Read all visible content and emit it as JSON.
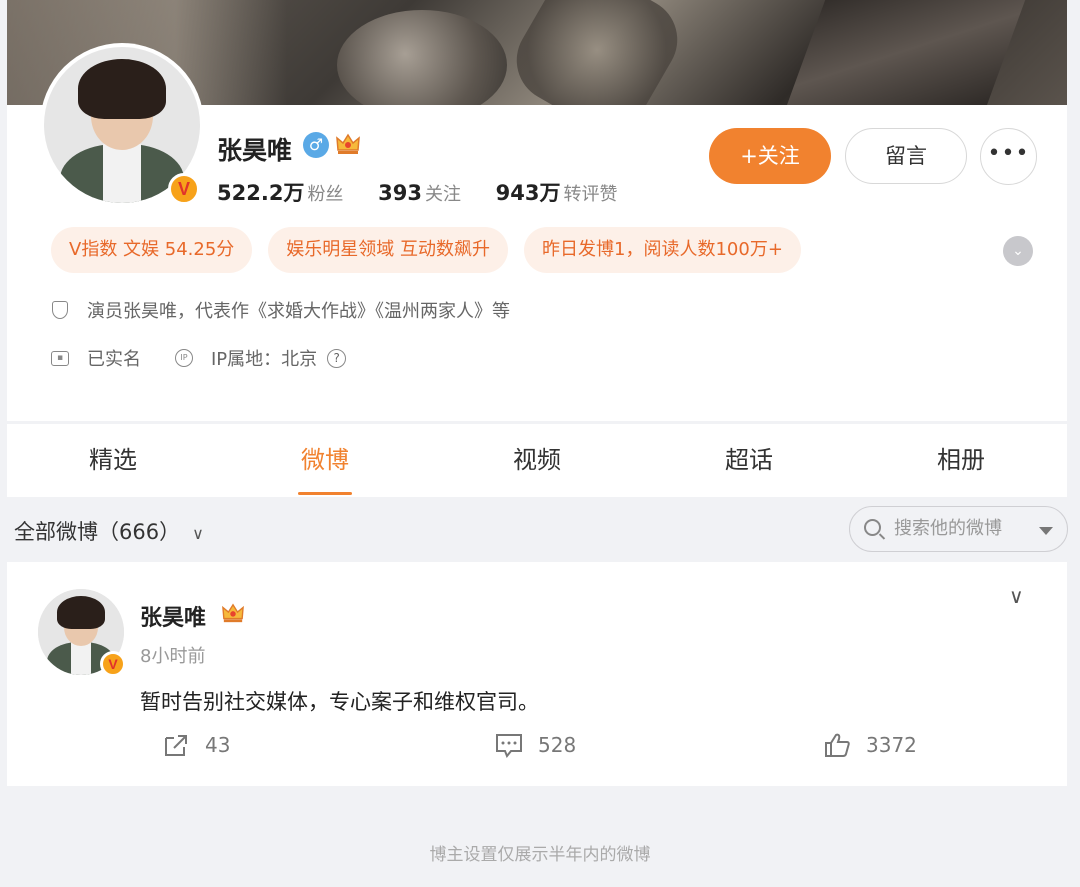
{
  "profile": {
    "name": "张昊唯",
    "gender_symbol": "♂",
    "v_badge": "V",
    "stats": [
      {
        "value": "522.2万",
        "label": "粉丝"
      },
      {
        "value": "393",
        "label": "关注"
      },
      {
        "value": "943万",
        "label": "转评赞"
      }
    ],
    "follow_label": "+关注",
    "message_label": "留言",
    "more_label": "•••",
    "tags": [
      "V指数 文娱 54.25分",
      "娱乐明星领域 互动数飙升",
      "昨日发博1，阅读人数100万+"
    ],
    "bio": "演员张昊唯，代表作《求婚大作战》《温州两家人》等",
    "verified_text": "已实名",
    "ip_text": "IP属地：北京",
    "help_symbol": "?"
  },
  "tabs": [
    "精选",
    "微博",
    "视频",
    "超话",
    "相册"
  ],
  "active_tab_index": 1,
  "filter": {
    "label": "全部微博（666）",
    "chevron": "∨"
  },
  "search": {
    "placeholder": "搜索他的微博"
  },
  "post": {
    "author": "张昊唯",
    "time": "8小时前",
    "text": "暂时告别社交媒体，专心案子和维权官司。",
    "reposts": "43",
    "comments": "528",
    "likes": "3372"
  },
  "footer_text": "博主设置仅展示半年内的微博",
  "colors": {
    "accent": "#f1822f",
    "tag_bg": "#fdf0e8",
    "tag_text": "#e8692a"
  }
}
